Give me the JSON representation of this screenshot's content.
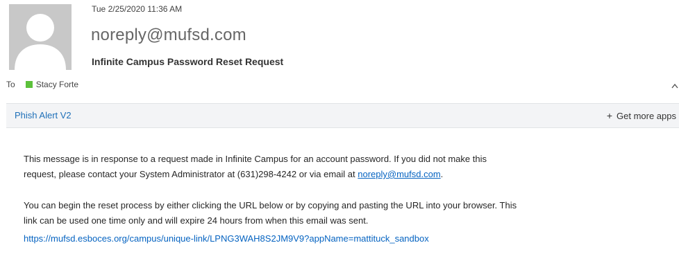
{
  "header": {
    "date": "Tue 2/25/2020 11:36 AM",
    "sender": "noreply@mufsd.com",
    "subject": "Infinite Campus Password Reset Request",
    "to_label": "To",
    "recipient": "Stacy Forte",
    "presence_color": "#5cc13b",
    "avatar_icon": "person-silhouette-icon"
  },
  "addin_bar": {
    "addin_name": "Phish Alert V2",
    "get_more_label": "Get more apps",
    "plus_glyph": "+"
  },
  "body": {
    "p1_line1": "This message is in response to a request made in Infinite Campus for an account password. If you did not make this",
    "p1_line2_prefix": "request, please contact your System Administrator at (631)298-4242 or via email at",
    "p1_email_link": "noreply@mufsd.com",
    "p1_line2_suffix": ".",
    "p2_line1": "You can begin the reset process by either clicking the URL below or by copying and pasting the URL into your browser. This",
    "p2_line2": "link can be used one time only and will expire 24 hours from when this email was sent.",
    "reset_url": "https://mufsd.esboces.org/campus/unique-link/LPNG3WAH8S2JM9V9?appName=mattituck_sandbox"
  }
}
